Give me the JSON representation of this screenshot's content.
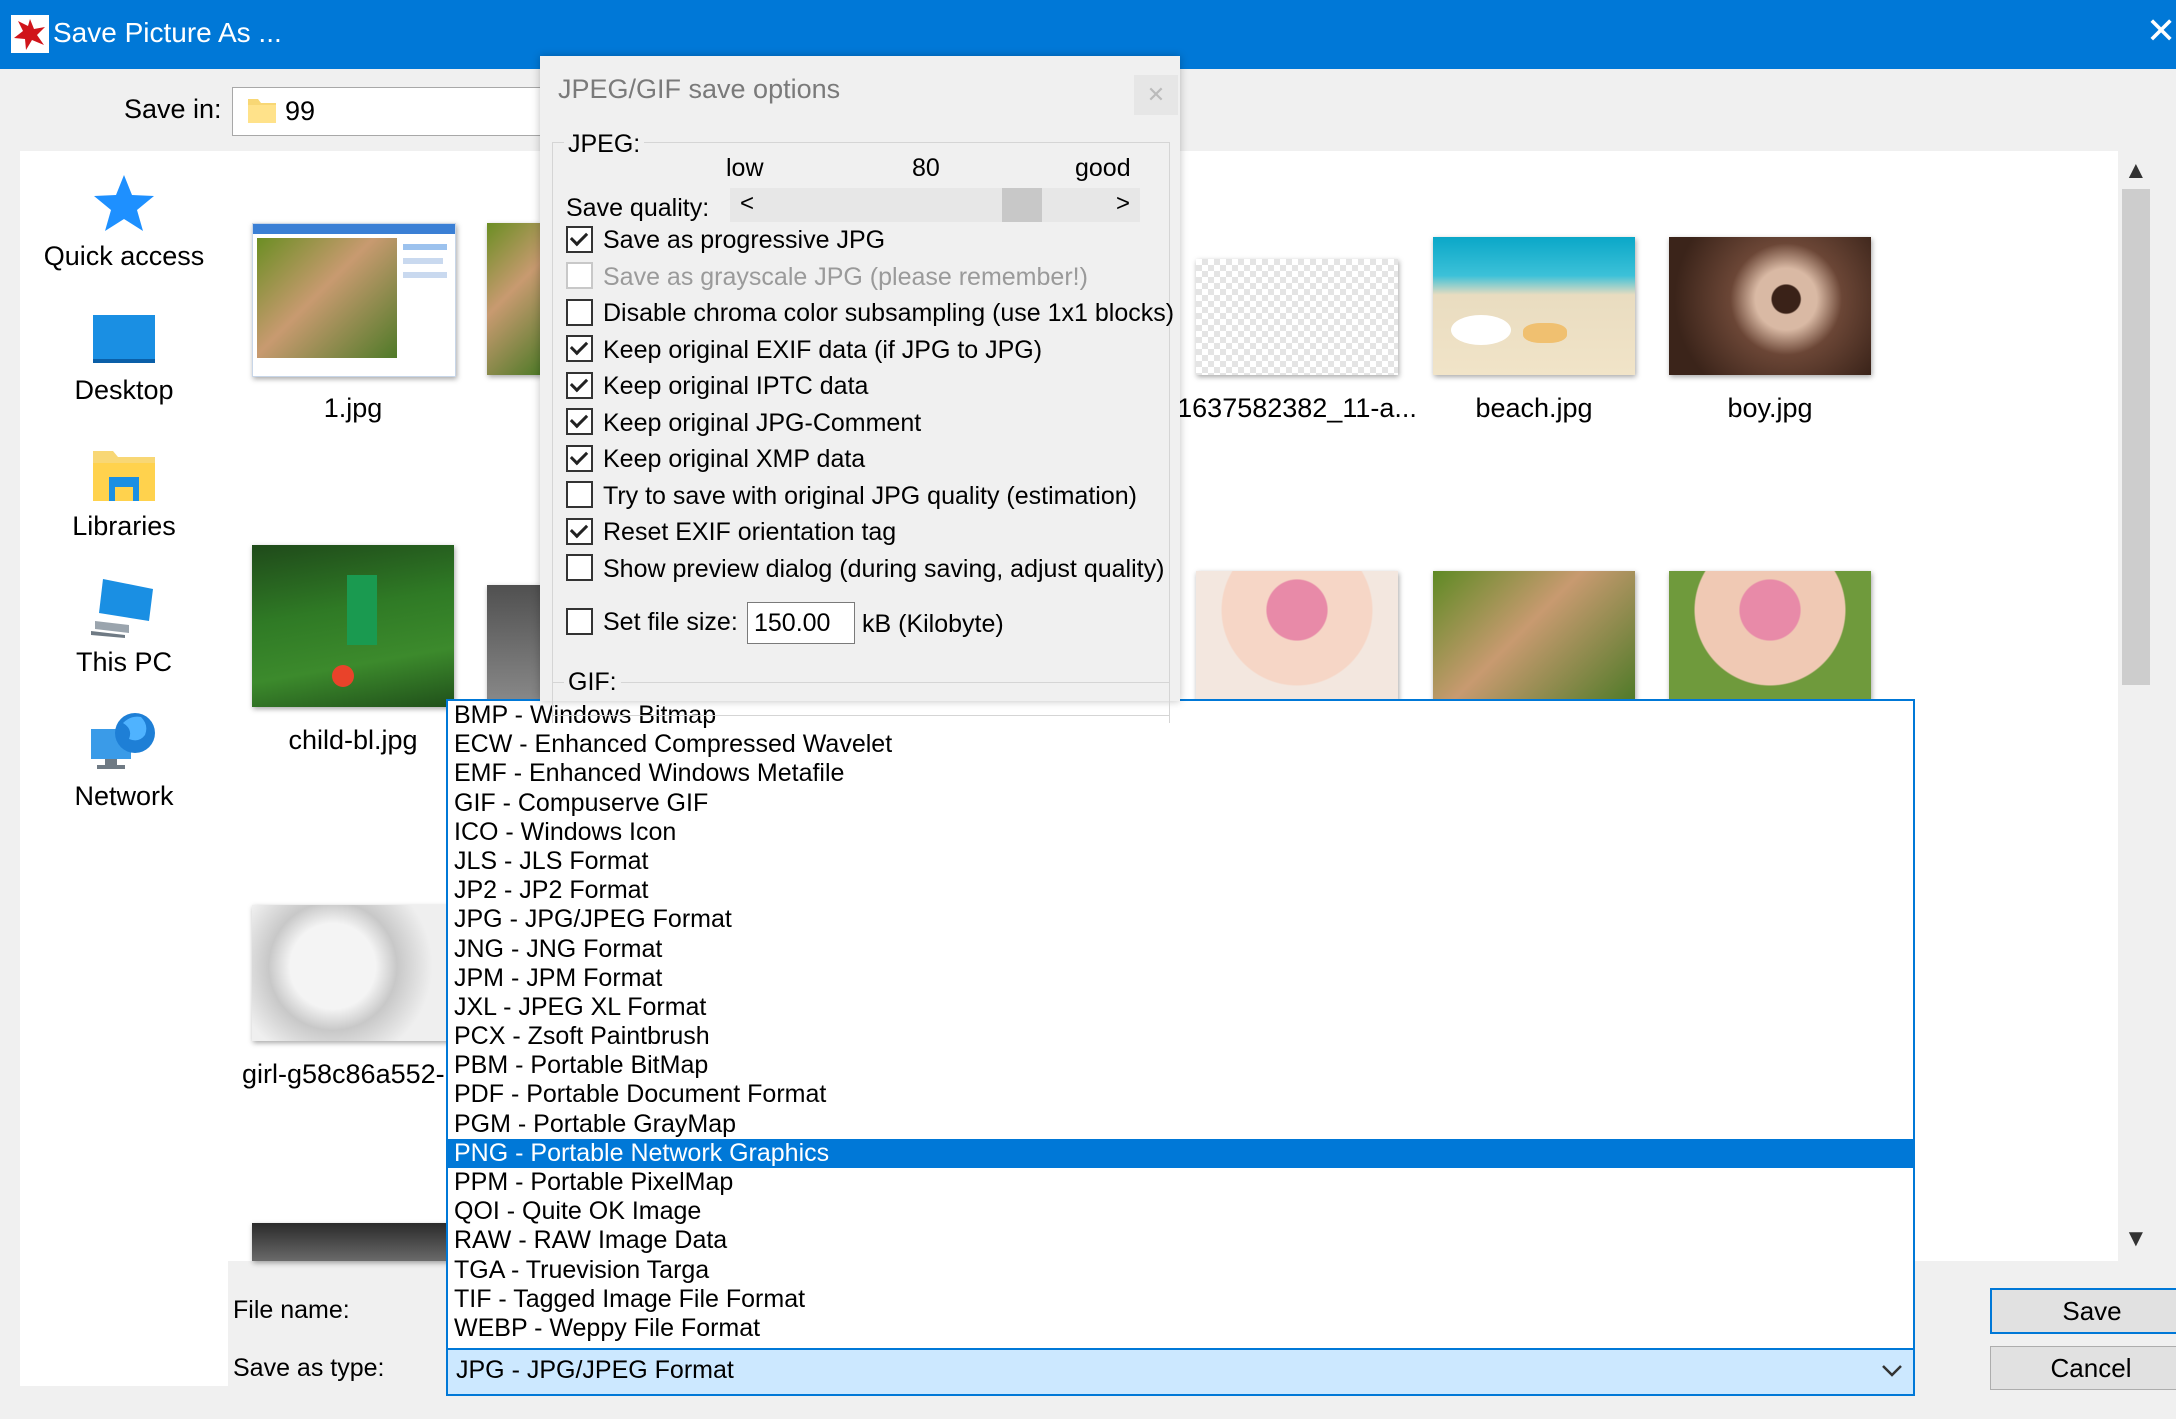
{
  "window": {
    "title": "Save Picture As ..."
  },
  "save_in": {
    "label": "Save in:",
    "value": "99"
  },
  "places": [
    "Quick access",
    "Desktop",
    "Libraries",
    "This PC",
    "Network"
  ],
  "files": {
    "names": [
      "1.jpg",
      "1637582382_11-a...",
      "beach.jpg",
      "boy.jpg",
      "child-bl.jpg",
      "girl-g58c86a552-"
    ]
  },
  "bottom": {
    "filename_label": "File name:",
    "savetype_label": "Save as type:",
    "savetype_value": "JPG - JPG/JPEG Format",
    "save_button": "Save",
    "cancel_button": "Cancel"
  },
  "filetype_options": [
    "BMP - Windows Bitmap",
    "ECW - Enhanced Compressed Wavelet",
    "EMF - Enhanced Windows Metafile",
    "GIF - Compuserve GIF",
    "ICO - Windows Icon",
    "JLS - JLS Format",
    "JP2 - JP2 Format",
    "JPG - JPG/JPEG Format",
    "JNG - JNG Format",
    "JPM - JPM Format",
    "JXL - JPEG XL Format",
    "PCX - Zsoft Paintbrush",
    "PBM - Portable BitMap",
    "PDF - Portable Document Format",
    "PGM - Portable GrayMap",
    "PNG - Portable Network Graphics",
    "PPM - Portable PixelMap",
    "QOI - Quite OK Image",
    "RAW - RAW Image Data",
    "TGA - Truevision Targa",
    "TIF - Tagged Image File Format",
    "WEBP - Weppy File Format"
  ],
  "selected_option": "PNG - Portable Network Graphics",
  "jpeg_dialog": {
    "title": "JPEG/GIF save options",
    "jpeg_group": "JPEG:",
    "gif_group": "GIF:",
    "quality_label": "Save quality:",
    "quality_low": "low",
    "quality_value": "80",
    "quality_good": "good",
    "quality_level": 80,
    "options": [
      {
        "label": "Save as progressive JPG",
        "checked": true,
        "disabled": false
      },
      {
        "label": "Save as grayscale JPG (please remember!)",
        "checked": false,
        "disabled": true
      },
      {
        "label": "Disable chroma color subsampling (use 1x1 blocks)",
        "checked": false,
        "disabled": false
      },
      {
        "label": "Keep original EXIF data (if JPG to JPG)",
        "checked": true,
        "disabled": false
      },
      {
        "label": "Keep original IPTC data",
        "checked": true,
        "disabled": false
      },
      {
        "label": "Keep original JPG-Comment",
        "checked": true,
        "disabled": false
      },
      {
        "label": "Keep original XMP data",
        "checked": true,
        "disabled": false
      },
      {
        "label": "Try to save with original JPG quality (estimation)",
        "checked": false,
        "disabled": false
      },
      {
        "label": "Reset EXIF orientation tag",
        "checked": true,
        "disabled": false
      },
      {
        "label": "Show preview dialog (during saving, adjust quality)",
        "checked": false,
        "disabled": false
      }
    ],
    "filesize": {
      "label": "Set file size:",
      "checked": false,
      "value": "150.00",
      "unit": "kB (Kilobyte)"
    }
  },
  "colors": {
    "accent": "#0078d7",
    "selection": "#0078d7",
    "combo_bg": "#cce8ff"
  },
  "icons": {
    "app": "irfanview-app-icon",
    "folder": "folder-icon",
    "quick_access": "star-icon",
    "desktop": "desktop-icon",
    "libraries": "libraries-icon",
    "this_pc": "computer-icon",
    "network": "network-globe-icon"
  }
}
